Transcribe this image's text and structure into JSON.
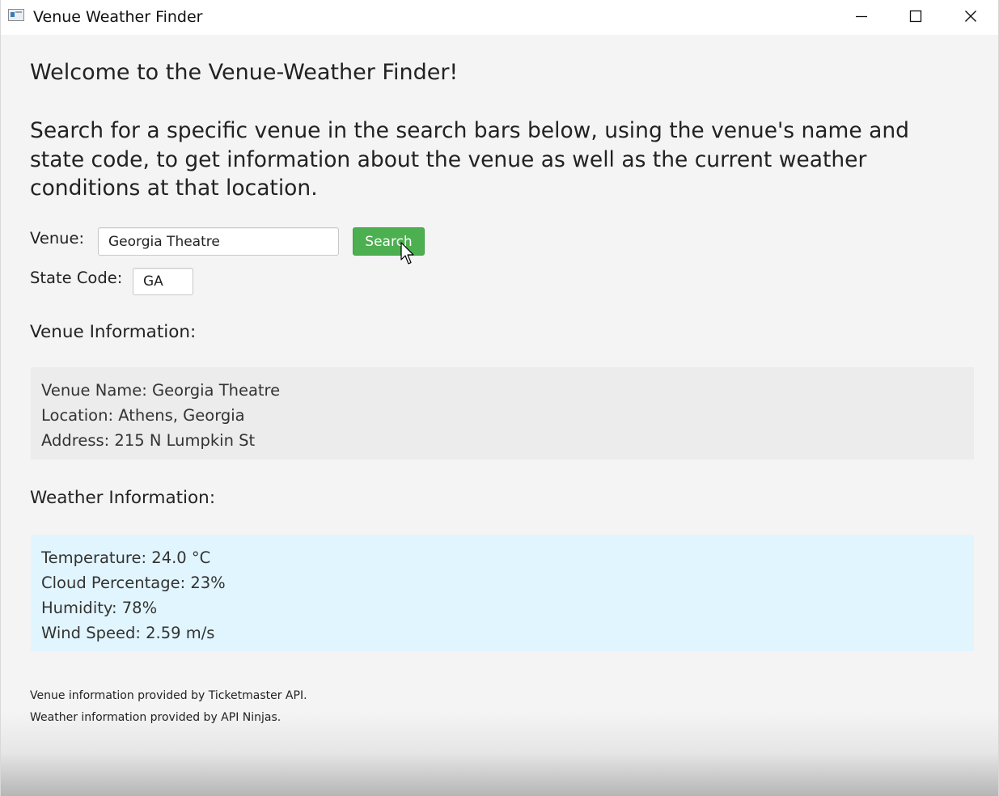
{
  "window": {
    "title": "Venue Weather Finder"
  },
  "header": {
    "welcome": "Welcome to the Venue-Weather Finder!",
    "intro": "Search for a specific venue in the search bars below, using the venue's name and state code, to get information about the venue as well as the current weather conditions at that location."
  },
  "search": {
    "venue_label": "Venue:",
    "venue_value": "Georgia Theatre",
    "button_label": "Search",
    "state_label": "State Code:",
    "state_value": "GA"
  },
  "venue_info": {
    "title": "Venue Information:",
    "lines": [
      "Venue Name: Georgia Theatre",
      "Location: Athens, Georgia",
      "Address: 215 N Lumpkin St"
    ]
  },
  "weather_info": {
    "title": "Weather Information:",
    "lines": [
      "Temperature: 24.0 °C",
      "Cloud Percentage: 23%",
      "Humidity: 78%",
      "Wind Speed: 2.59 m/s"
    ]
  },
  "footer": {
    "line1": "Venue information provided by Ticketmaster API.",
    "line2": "Weather information provided by API Ninjas."
  },
  "colors": {
    "search_button": "#4caf50",
    "weather_box": "#e1f5fe",
    "venue_box": "#ececec"
  }
}
